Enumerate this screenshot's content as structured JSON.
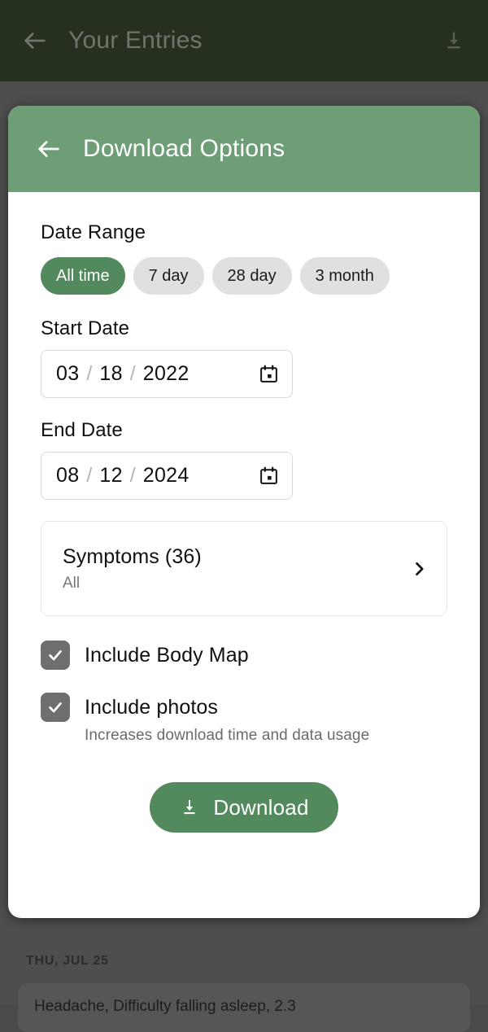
{
  "background_app": {
    "appbar": {
      "back_icon": "arrow-left-icon",
      "title": "Your Entries",
      "download_icon": "download-icon"
    },
    "entries": {
      "date_header": "THU, JUL 25",
      "first_entry_preview": "Headache, Difficulty falling asleep, 2.3"
    }
  },
  "modal": {
    "header": {
      "back_icon": "arrow-left-icon",
      "title": "Download Options"
    },
    "date_range": {
      "label": "Date Range",
      "options": [
        {
          "label": "All time",
          "selected": true
        },
        {
          "label": "7 day",
          "selected": false
        },
        {
          "label": "28 day",
          "selected": false
        },
        {
          "label": "3 month",
          "selected": false
        }
      ]
    },
    "start_date": {
      "label": "Start Date",
      "month": "03",
      "day": "18",
      "year": "2022",
      "separator": "/",
      "calendar_icon": "calendar-icon"
    },
    "end_date": {
      "label": "End Date",
      "month": "08",
      "day": "12",
      "year": "2024",
      "separator": "/",
      "calendar_icon": "calendar-icon"
    },
    "symptoms": {
      "title": "Symptoms (36)",
      "subtitle": "All",
      "chevron_icon": "chevron-right-icon"
    },
    "include_body_map": {
      "label": "Include Body Map",
      "checked": true
    },
    "include_photos": {
      "label": "Include photos",
      "helper": "Increases download time and data usage",
      "checked": true
    },
    "download_button": {
      "label": "Download",
      "icon": "download-icon"
    }
  },
  "colors": {
    "brand_green": "#538a5d",
    "header_green": "#6d9e75",
    "appbar_dark_green": "#25301f",
    "chip_inactive": "#e0e0e0",
    "checkbox_gray": "#6f6f6f",
    "scrim": "#4e4e4e"
  }
}
